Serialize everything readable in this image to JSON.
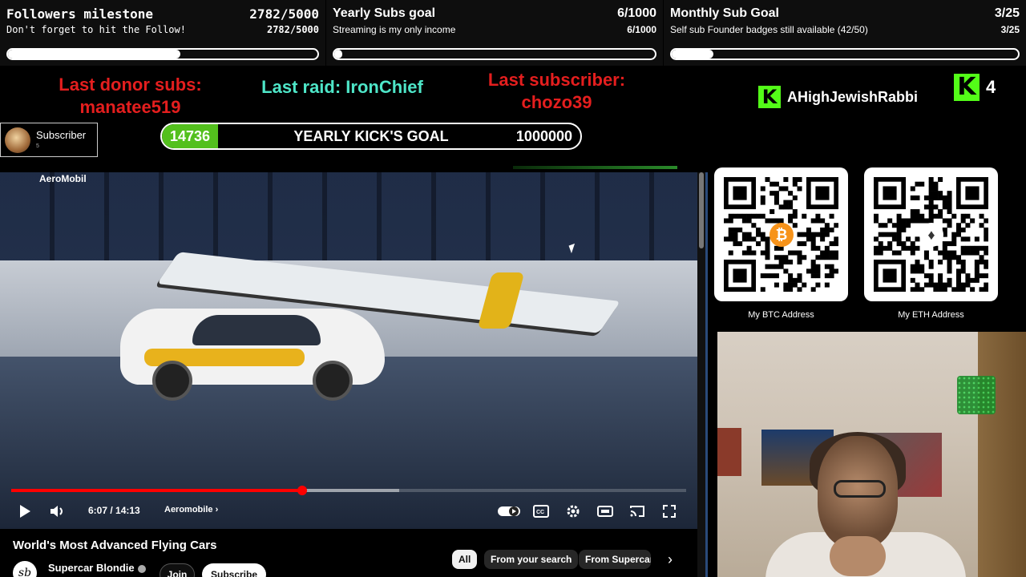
{
  "goals": [
    {
      "title": "Followers milestone",
      "value": "2782/5000",
      "subtitle": "Don't forget to hit the Follow!",
      "subvalue": "2782/5000",
      "progress": 0.556
    },
    {
      "title": "Yearly Subs goal",
      "value": "6/1000",
      "subtitle": "Streaming is my only income",
      "subvalue": "6/1000",
      "progress": 0.006
    },
    {
      "title": "Monthly Sub Goal",
      "value": "3/25",
      "subtitle": "Self sub Founder badges still available (42/50)",
      "subvalue": "3/25",
      "progress": 0.12
    }
  ],
  "alerts": {
    "last_donor": "Last donor subs:\nmanatee519",
    "last_donor_line1": "Last donor subs:",
    "last_donor_line2": "manatee519",
    "last_raid": "Last raid: IronChief",
    "last_sub_line1": "Last subscriber:",
    "last_sub_line2": "chozo39"
  },
  "kick": {
    "logo_letter": "K",
    "username": "AHighJewishRabbi",
    "viewer_count": "4"
  },
  "subscriber_box": {
    "label": "Subscriber",
    "count": "5"
  },
  "kick_goal": {
    "current": "14736",
    "title": "YEARLY KICK'S GOAL",
    "target": "1000000"
  },
  "video": {
    "channel_tag": "AeroMobil",
    "time": "6:07 / 14:13",
    "chapter": "Aeromobile",
    "chapter_chevron": "›",
    "played_fraction": 0.431,
    "buffered_fraction": 0.575,
    "title": "World's Most Advanced Flying Cars",
    "channel_name": "Supercar Blondie",
    "channel_avatar_text": "sb",
    "join_label": "Join",
    "subscribe_label": "Subscribe",
    "icons": [
      "play-icon",
      "volume-icon",
      "autoplay-toggle-icon",
      "captions-icon",
      "settings-icon",
      "theater-mode-icon",
      "cast-icon",
      "fullscreen-icon"
    ]
  },
  "chips": [
    {
      "label": "All",
      "active": true
    },
    {
      "label": "From your search",
      "active": false
    },
    {
      "label": "From Supercar",
      "active": false
    }
  ],
  "chip_next": "›",
  "qr": {
    "btc_caption": "My BTC Address",
    "eth_caption": "My ETH Address",
    "btc_symbol": "₿",
    "eth_symbol": "♦"
  },
  "colors": {
    "kick_green": "#53fc18",
    "alert_red": "#e41e1e",
    "raid_teal": "#4ee6c8",
    "yt_red": "#ff0000",
    "btc_orange": "#f7931a"
  }
}
